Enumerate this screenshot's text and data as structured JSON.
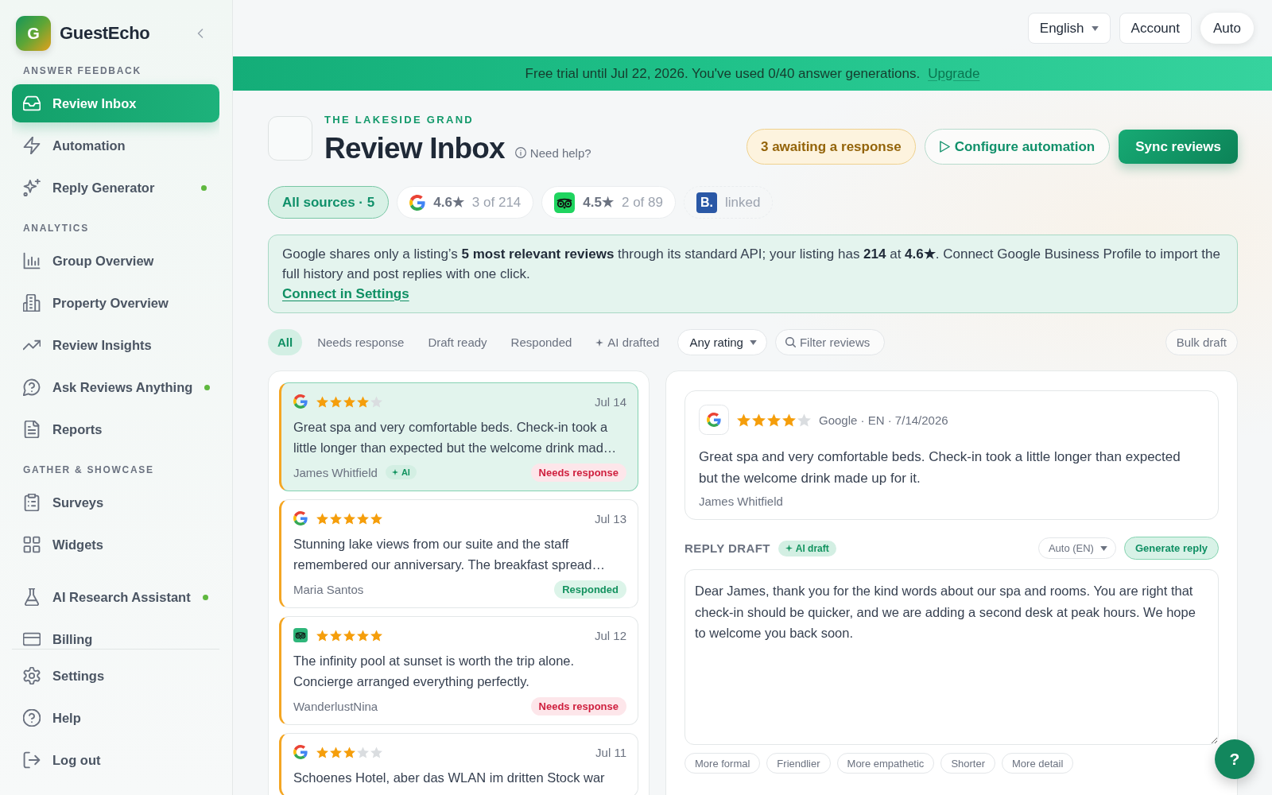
{
  "sidebar": {
    "brand": {
      "initial": "G",
      "name": "GuestEcho"
    },
    "sections": [
      {
        "heading": "ANSWER FEEDBACK",
        "items": [
          {
            "label": "Review Inbox",
            "selected": true,
            "dot": false
          },
          {
            "label": "Automation",
            "selected": false,
            "dot": false
          },
          {
            "label": "Reply Generator",
            "selected": false,
            "dot": true
          }
        ]
      },
      {
        "heading": "ANALYTICS",
        "items": [
          {
            "label": "Group Overview",
            "selected": false,
            "dot": false
          },
          {
            "label": "Property Overview",
            "selected": false,
            "dot": false
          },
          {
            "label": "Review Insights",
            "selected": false,
            "dot": false
          },
          {
            "label": "Ask Reviews Anything",
            "selected": false,
            "dot": true
          },
          {
            "label": "Reports",
            "selected": false,
            "dot": false
          }
        ]
      },
      {
        "heading": "GATHER & SHOWCASE",
        "items": [
          {
            "label": "Surveys",
            "selected": false,
            "dot": false
          },
          {
            "label": "Widgets",
            "selected": false,
            "dot": false
          }
        ]
      },
      {
        "items": [
          {
            "label": "AI Research Assistant",
            "selected": false,
            "dot": true
          },
          {
            "label": "Billing",
            "selected": false,
            "dot": false
          }
        ]
      }
    ],
    "footer_items": [
      {
        "label": "Settings",
        "selected": false
      },
      {
        "label": "Help",
        "selected": false
      },
      {
        "label": "Log out",
        "selected": false
      }
    ]
  },
  "top_bar": {
    "language": "English",
    "account": "Account",
    "theme": "Auto"
  },
  "banner": {
    "text": "Free trial until Jul 22, 2026. You've used 0/40 answer generations.",
    "link": "Upgrade"
  },
  "header": {
    "property": "THE LAKESIDE GRAND",
    "title": "Review Inbox",
    "help": "Need help?",
    "actions": [
      {
        "kind": "pending",
        "label": "3 awaiting a response"
      },
      {
        "kind": "outline",
        "label": "Configure automation"
      },
      {
        "kind": "primary",
        "label": "Sync reviews"
      }
    ]
  },
  "sources": [
    {
      "kind": "all",
      "label": "All sources · 5",
      "selected": true
    },
    {
      "kind": "google",
      "rating": "4.6★",
      "count": "3 of 214",
      "selected": false
    },
    {
      "kind": "tripadvisor",
      "rating": "4.5★",
      "count": "2 of 89",
      "selected": false
    },
    {
      "kind": "booking",
      "logo": "B.",
      "status": "linked",
      "selected": false
    }
  ],
  "notice": {
    "text": "Google shares only a listing’s **5 most relevant reviews** through its standard API; your listing has **214** at **4.6★**. Connect Google Business Profile to import the full history and post replies with one click.",
    "link": "Connect in Settings"
  },
  "filters": {
    "tabs": [
      {
        "kind": "plain",
        "label": "All",
        "selected": true
      },
      {
        "kind": "plain",
        "label": "Needs response",
        "selected": false
      },
      {
        "kind": "plain",
        "label": "Draft ready",
        "selected": false
      },
      {
        "kind": "plain",
        "label": "Responded",
        "selected": false
      },
      {
        "kind": "ai",
        "label": "AI drafted",
        "selected": false
      }
    ],
    "rating": "Any rating",
    "search": {
      "placeholder": "Filter reviews"
    },
    "bulk": "Bulk draft"
  },
  "reviews": [
    {
      "kind": "google",
      "stars": 4,
      "date": "Jul 14",
      "text": "Great spa and very comfortable beds. Check-in took a little longer than expected but the welcome drink mad…",
      "author": "James Whitfield",
      "tag": "AI",
      "status": {
        "kind": "needs_response",
        "label": "Needs response"
      },
      "selected": true
    },
    {
      "kind": "google",
      "stars": 5,
      "date": "Jul 13",
      "text": "Stunning lake views from our suite and the staff remembered our anniversary. The breakfast spread…",
      "author": "Maria Santos",
      "status": {
        "kind": "responded",
        "label": "Responded"
      },
      "selected": false
    },
    {
      "kind": "tripadvisor",
      "stars": 5,
      "date": "Jul 12",
      "text": "The infinity pool at sunset is worth the trip alone. Concierge arranged everything perfectly.",
      "author": "WanderlustNina",
      "status": {
        "kind": "needs_response",
        "label": "Needs response"
      },
      "selected": false
    },
    {
      "kind": "google",
      "stars": 3,
      "date": "Jul 11",
      "text": "Schoenes Hotel, aber das WLAN im dritten Stock war",
      "selected": false
    }
  ],
  "detail": {
    "kind": "google",
    "stars": 4,
    "meta": "Google · EN · 7/14/2026",
    "text": "Great spa and very comfortable beds. Check-in took a little longer than expected but the welcome drink made up for it.",
    "author": "James Whitfield"
  },
  "reply": {
    "heading": "REPLY DRAFT",
    "badge": "AI draft",
    "language": "Auto (EN)",
    "generate": "Generate reply",
    "value": "Dear James, thank you for the kind words about our spa and rooms. You are right that check-in should be quicker, and we are adding a second desk at peak hours. We hope to welcome you back soon.",
    "refinements": [
      "More formal",
      "Friendlier",
      "More empathetic",
      "Shorter",
      "More detail"
    ]
  },
  "help_button": "?"
}
